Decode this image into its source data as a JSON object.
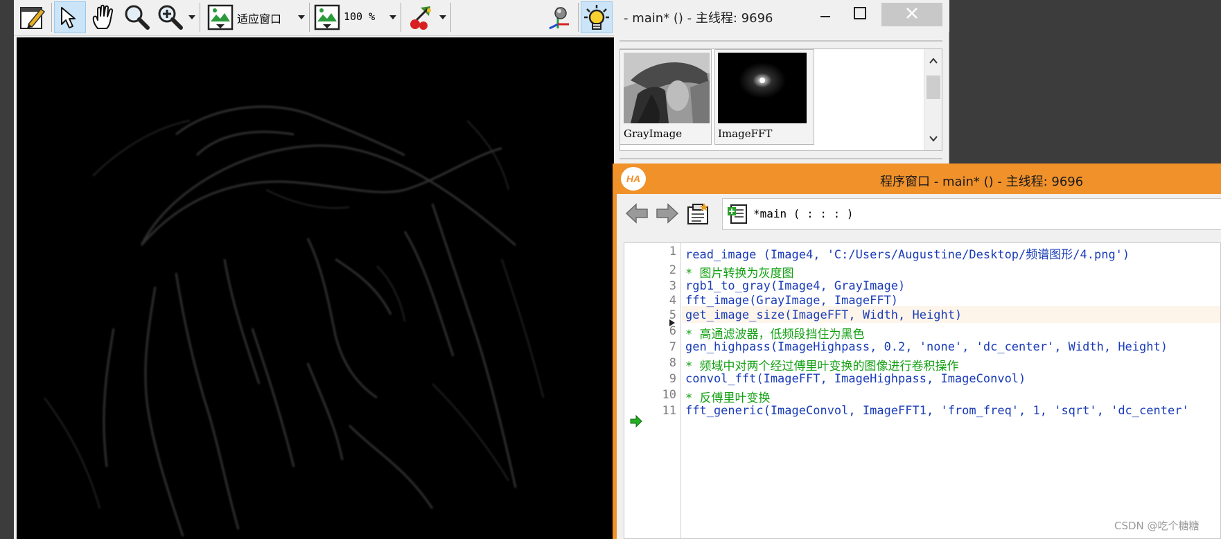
{
  "graphics_window": {
    "zoom_mode_label": "适应窗口",
    "zoom_percent_label": "100 %"
  },
  "variable_window": {
    "title": "- main* () - 主线程: 9696",
    "items": [
      {
        "name": "GrayImage"
      },
      {
        "name": "ImageFFT"
      }
    ]
  },
  "program_window": {
    "logo_text": "HA",
    "title": "程序窗口 - main* () - 主线程: 9696",
    "procedure_label": "*main ( : : : )",
    "lines": [
      {
        "no": "1",
        "text": "read_image (Image4, 'C:/Users/Augustine/Desktop/频谱图形/4.png')",
        "type": "code"
      },
      {
        "no": "2",
        "text": "* 图片转换为灰度图",
        "type": "comment"
      },
      {
        "no": "3",
        "text": "rgb1_to_gray(Image4, GrayImage)",
        "type": "code"
      },
      {
        "no": "4",
        "text": "fft_image(GrayImage, ImageFFT)",
        "type": "code"
      },
      {
        "no": "5",
        "text": "get_image_size(ImageFFT, Width, Height)",
        "type": "code"
      },
      {
        "no": "6",
        "text": "* 高通滤波器，低频段挡住为黑色",
        "type": "comment"
      },
      {
        "no": "7",
        "text": "gen_highpass(ImageHighpass, 0.2, 'none', 'dc_center', Width, Height)",
        "type": "code"
      },
      {
        "no": "8",
        "text": "* 频域中对两个经过傅里叶变换的图像进行卷积操作",
        "type": "comment"
      },
      {
        "no": "9",
        "text": "convol_fft(ImageFFT, ImageHighpass, ImageConvol)",
        "type": "code"
      },
      {
        "no": "10",
        "text": "* 反傅里叶变换",
        "type": "comment"
      },
      {
        "no": "11",
        "text": "fft_generic(ImageConvol, ImageFFT1, 'from_freq', 1, 'sqrt', 'dc_center'",
        "type": "code"
      }
    ]
  },
  "watermark": "CSDN @吃个糖糖",
  "colors": {
    "accent_orange": "#f0912a",
    "code_blue": "#1a3cb8",
    "comment_green": "#12a012"
  },
  "icons": [
    "set-parameters-icon",
    "pointer-icon",
    "hand-icon",
    "magnify-icon",
    "zoom-in-icon",
    "fit-window-icon",
    "zoom-percent-icon",
    "draw-color-icon",
    "3d-view-icon",
    "lightbulb-icon",
    "minimize-icon",
    "maximize-icon",
    "close-icon",
    "back-arrow-icon",
    "forward-arrow-icon",
    "clipboard-icon",
    "procedure-icon",
    "pc-arrow-icon",
    "cursor-marker-icon"
  ]
}
